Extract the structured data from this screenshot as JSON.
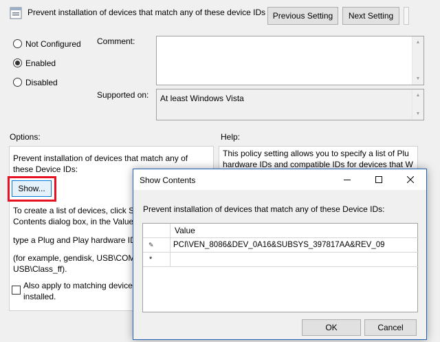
{
  "header": {
    "title": "Prevent installation of devices that match any of these device IDs",
    "prev_button": "Previous Setting",
    "next_button": "Next Setting"
  },
  "state": {
    "options": [
      {
        "label": "Not Configured",
        "checked": false
      },
      {
        "label": "Enabled",
        "checked": true
      },
      {
        "label": "Disabled",
        "checked": false
      }
    ]
  },
  "labels": {
    "comment": "Comment:",
    "supported_on": "Supported on:",
    "supported_value": "At least Windows Vista",
    "options": "Options:",
    "help": "Help:"
  },
  "options_panel": {
    "line1": "Prevent installation of devices that match any of",
    "line2": "these Device IDs:",
    "show_button": "Show...",
    "instr1": "To create a list of devices, click Sh",
    "instr2": "Contents dialog box, in the Value",
    "instr3": "type a Plug and Play hardware ID",
    "instr4": "(for example, gendisk, USB\\COMI",
    "instr5": "USB\\Class_ff).",
    "checkbox_line1": "Also apply to matching device",
    "checkbox_line2": "installed."
  },
  "help_panel": {
    "line1": "This policy setting allows you to specify a list of Plu",
    "line2": "hardware IDs and compatible IDs for devices that W"
  },
  "dialog": {
    "title": "Show Contents",
    "prompt": "Prevent installation of devices that match any of these Device IDs:",
    "column_header": "Value",
    "rows": [
      {
        "marker": "✎",
        "value": "PCI\\VEN_8086&DEV_0A16&SUBSYS_397817AA&REV_09"
      },
      {
        "marker": "*",
        "value": ""
      }
    ],
    "ok": "OK",
    "cancel": "Cancel"
  },
  "colors": {
    "highlight": "#e81123",
    "dialog_border": "#1c5fb2"
  }
}
